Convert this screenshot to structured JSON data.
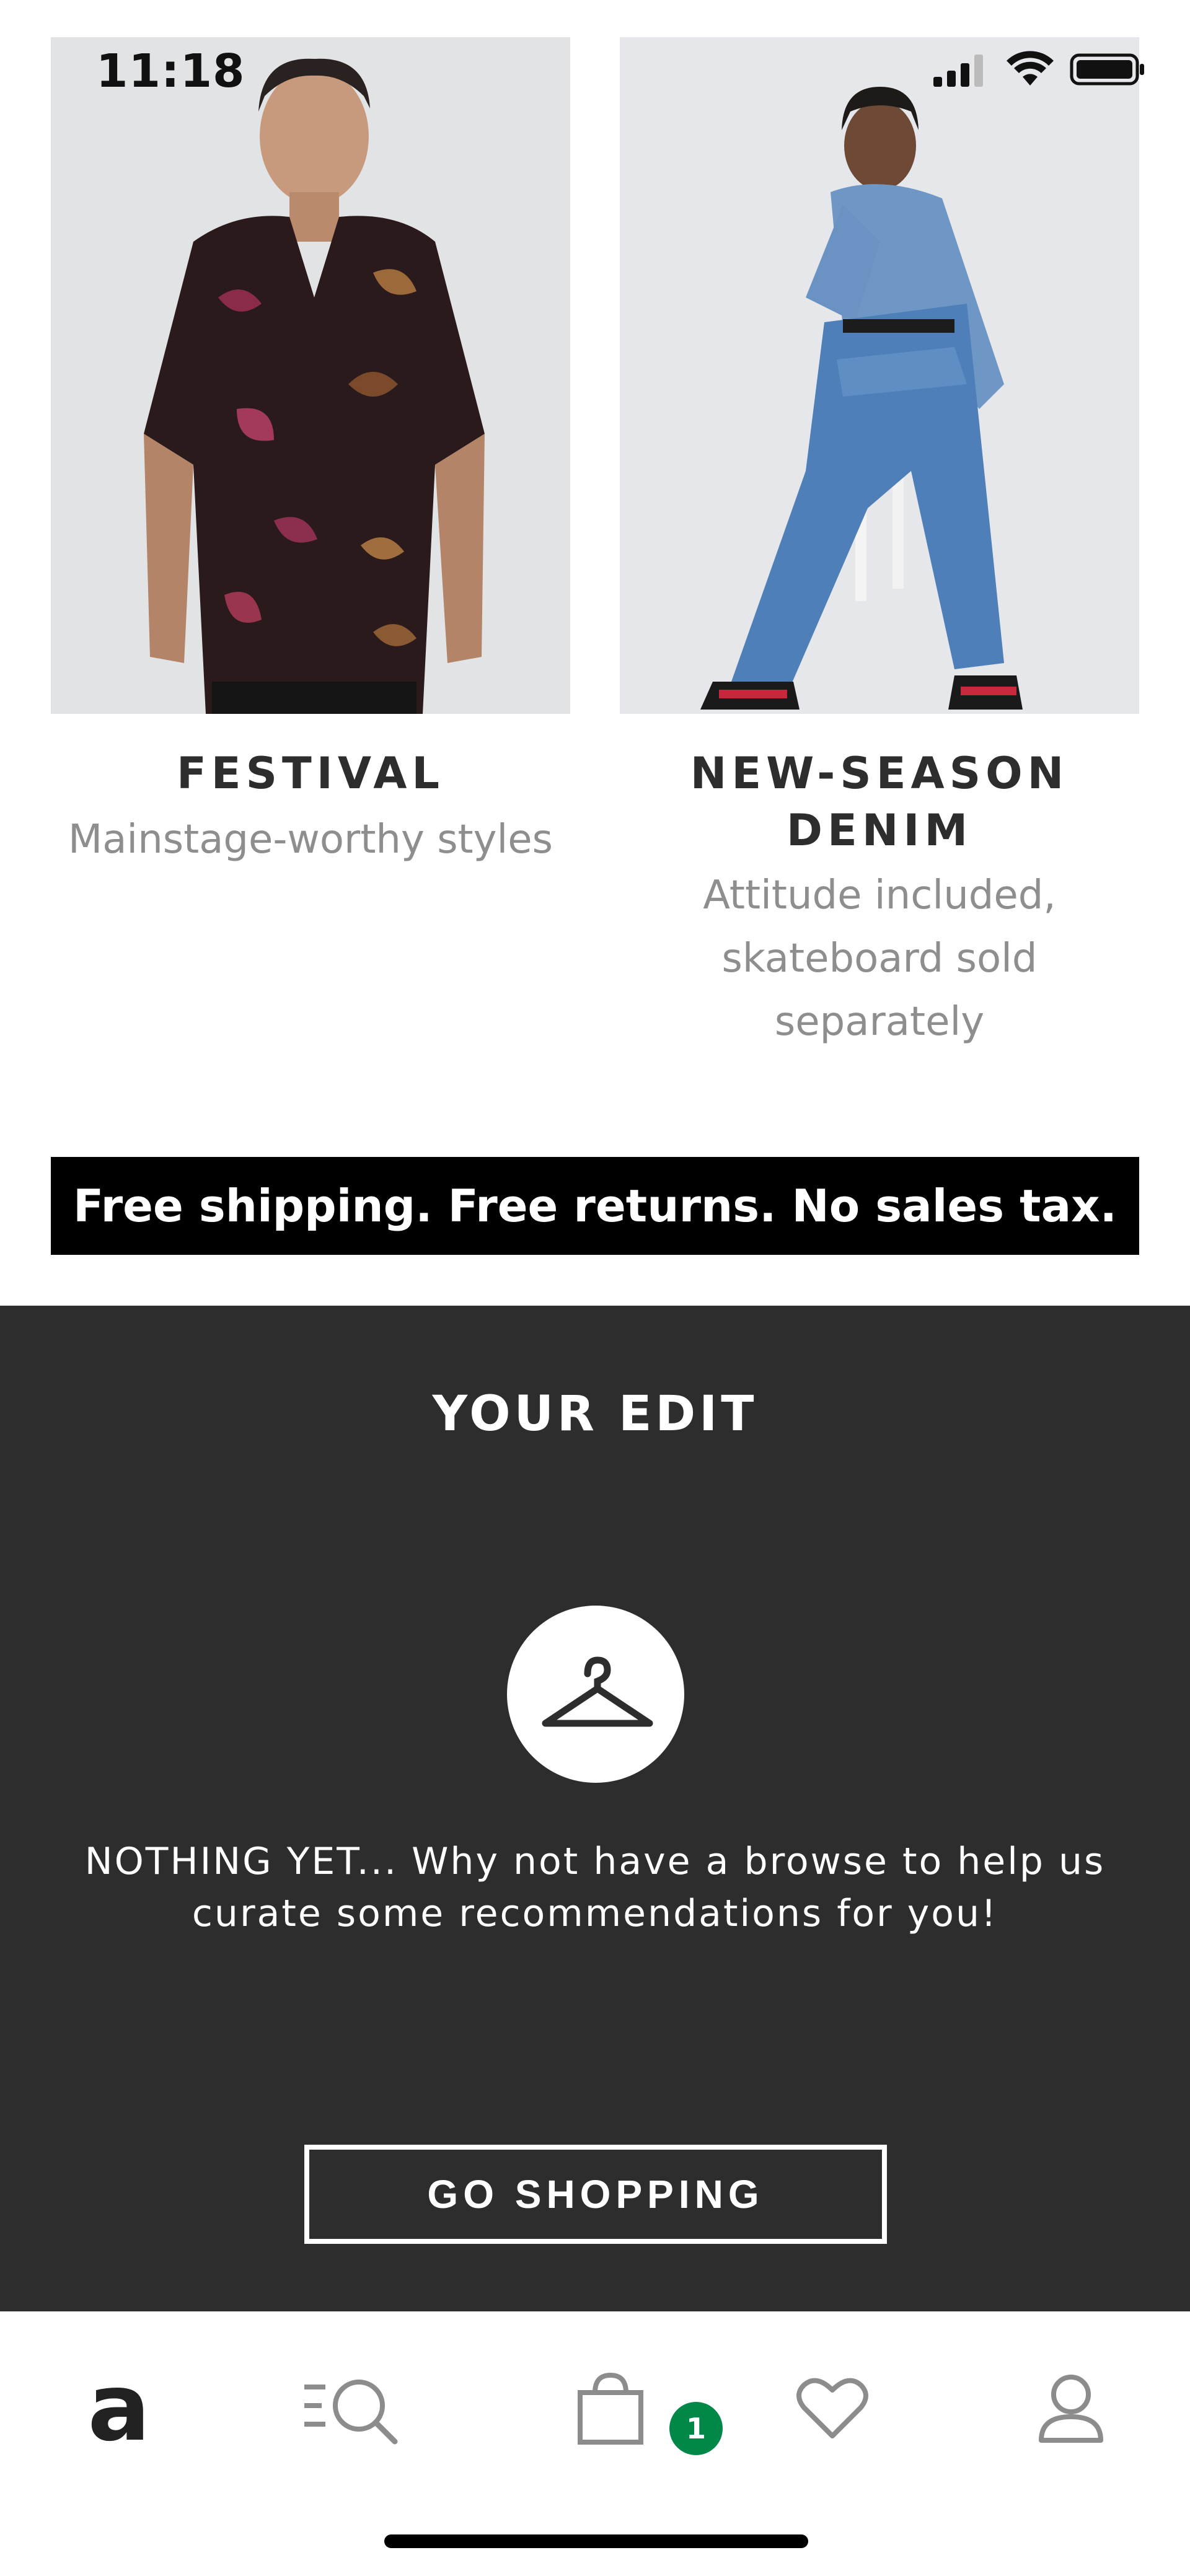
{
  "status_bar": {
    "time": "11:18"
  },
  "promos": [
    {
      "title": "FESTIVAL",
      "subtitle": "Mainstage-worthy styles",
      "image_alt": "Man in floral short-sleeve shirt"
    },
    {
      "title": "NEW-SEASON DENIM",
      "subtitle": "Attitude included, skateboard sold separately",
      "image_alt": "Man in denim jacket and wide-leg jeans seated on stool"
    }
  ],
  "shipping_banner": {
    "text": "Free shipping. Free returns. No sales tax."
  },
  "your_edit": {
    "title": "YOUR EDIT",
    "icon": "hanger-icon",
    "message": "NOTHING YET... Why not have a browse to help us curate some recommendations for you!",
    "button_label": "GO SHOPPING"
  },
  "bottom_nav": {
    "home_logo": "a",
    "bag_count": "1",
    "items": [
      "home-icon",
      "search-icon",
      "bag-icon",
      "heart-icon",
      "account-icon"
    ]
  },
  "colors": {
    "edit_background": "#2d2d2d",
    "badge_green": "#018849",
    "banner_black": "#000000",
    "subtitle_gray": "#8e8e8e"
  }
}
